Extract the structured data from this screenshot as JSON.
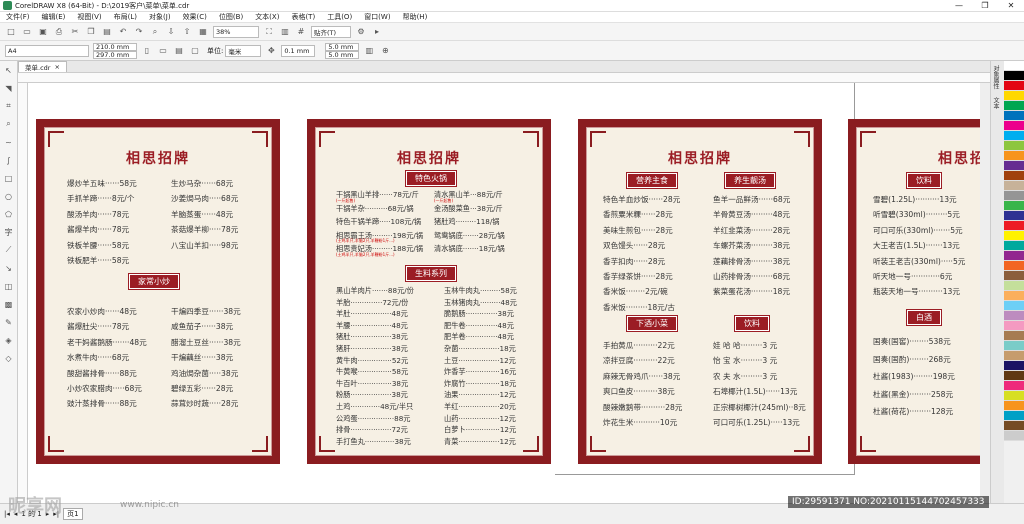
{
  "window": {
    "title": "CorelDRAW X8 (64-Bit) - D:\\2019客户\\菜单\\菜单.cdr",
    "controls": [
      "—",
      "❐",
      "✕"
    ]
  },
  "menu": [
    "文件(F)",
    "编辑(E)",
    "视图(V)",
    "布局(L)",
    "对象(J)",
    "效果(C)",
    "位图(B)",
    "文本(X)",
    "表格(T)",
    "工具(O)",
    "窗口(W)",
    "帮助(H)"
  ],
  "toolbar": {
    "zoom": "38%",
    "snap": "贴齐(T)"
  },
  "props": {
    "page": "A4",
    "width": "210.0 mm",
    "height": "297.0 mm",
    "unit_label": "单位:",
    "unit": "毫米",
    "nudge": "0.1 mm",
    "dup_x": "5.0 mm",
    "dup_y": "5.0 mm"
  },
  "doctab": "菜单.cdr",
  "dock": [
    "对象属性",
    "文本"
  ],
  "colors": [
    "#ffffff",
    "#000000",
    "#e30613",
    "#ffd800",
    "#00a651",
    "#0072bc",
    "#ec008c",
    "#00aeef",
    "#8dc63f",
    "#f7941d",
    "#662d91",
    "#a0410d",
    "#c7b299",
    "#959595",
    "#39b54a",
    "#2e3192",
    "#ed1c24",
    "#fff200",
    "#00a99d",
    "#92278f",
    "#f26522",
    "#8b5e3c",
    "#c4df9b",
    "#fbaf5d",
    "#6dcff6",
    "#bd8cbf",
    "#f49ac1",
    "#a67c52",
    "#7accc8",
    "#c69c6d",
    "#1b1464",
    "#603913",
    "#ee2a7b",
    "#d7df23",
    "#f7941d",
    "#00a0c6",
    "#754c24",
    "#ccc"
  ],
  "status": {
    "pages": "1 的 1",
    "page_tab": "页1"
  },
  "overlay": {
    "watermark": "昵享网",
    "url": "www.nipic.cn",
    "id": "ID:29591371 NO:20210115144702457333"
  },
  "cards": [
    {
      "title": "相思招牌",
      "left": [
        "爆炒羊五味······58元",
        "手抓羊蹄······8元/个",
        "酸汤羊肉······78元",
        "酱爆羊肉······78元",
        "铁板羊腰······58元",
        "铁板肥羊······58元"
      ],
      "right": [
        "生炒马杂······68元",
        "沙姜焗马肉·····68元",
        "羊脑蒸蛋······48元",
        "茶菇爆羊柳·····78元",
        "八宝山羊扣·····98元"
      ],
      "sec": "家常小炒",
      "left2": [
        "农家小炒肉······48元",
        "酱爆肚尖······78元",
        "老干妈酱鹅肠·······48元",
        "水煮牛肉······68元",
        "酸甜酱排骨······88元",
        "小炒农家腊肉·····68元",
        "豉汁蒸排骨······88元"
      ],
      "right2": [
        "干煸四季豆······38元",
        "咸鱼茄子······38元",
        "醋溜土豆丝······38元",
        "干煸藕丝······38元",
        "鸡油焗杂菌·····38元",
        "碧绿五彩······28元",
        "蒜茸炒时蔬·····28元"
      ]
    },
    {
      "title": "相思招牌",
      "sec1": "特色火锅",
      "left": [
        "干锅黑山羊排······78元/斤",
        "干锅羊杂··········68元/锅",
        "特色干锅羊蹄·····108元/锅",
        "相思霸王汤·········198元/锅",
        "相思贵妃汤·········188元/锅"
      ],
      "right": [
        "清水黑山羊···88元/斤",
        "金汤酸菜鱼···38元/斤",
        "猪肚鸡·········118/锅",
        "鸳鸯锅底·······28元/锅",
        "清水锅底·······18元/锅"
      ],
      "sec2": "生料系列",
      "left2": [
        "黑山羊肉片·······88元/份",
        "羊胎··············72元/份",
        "羊肚··················48元",
        "羊腰··················48元",
        "猪肚··················38元",
        "猪肝··················38元",
        "黄牛肉···············52元",
        "牛黄喉···············58元",
        "牛百叶···············38元",
        "粉肠··················38元",
        "土鸡·············48元/半只",
        "公鸡蛋················88元",
        "排骨··················72元",
        "手打鱼丸·············38元"
      ],
      "right2": [
        "玉林牛肉丸·········58元",
        "玉林猪肉丸·········48元",
        "脆鹅肠··············38元",
        "肥牛卷··············48元",
        "肥羊卷··············48元",
        "杂菌··················18元",
        "土豆··················12元",
        "炸香芋···············16元",
        "炸腐竹···············18元",
        "油果··················12元",
        "羊红··················20元",
        "山药··················12元",
        "白萝卜···············12元",
        "青菜··················12元"
      ],
      "notes": [
        "(一斤起售)",
        "(一斤起售)",
        "(土鸡半只,羊脑2只,羊鞭粉1斤...)",
        "(土鸡半只,羊脑2只,羊鞭粉1斤...)"
      ]
    },
    {
      "title": "相思招牌",
      "sec1": "营养主食",
      "sec2": "养生靓汤",
      "sec3": "下酒小菜",
      "sec4": "饮料",
      "a": [
        "特色羊血炒饭······28元",
        "香煎粟米粿······28元",
        "美味生煎包······28元",
        "双色馒头······28元",
        "香芋扣肉······28元",
        "香芋绿茶饼······28元",
        "香米饭········2元/碗",
        "香米饭·········18元/古"
      ],
      "b": [
        "鱼羊一品鲜汤······68元",
        "羊骨黄豆汤·········48元",
        "羊红韭菜汤·········28元",
        "车螺芥菜汤·········38元",
        "莲藕排骨汤·········38元",
        "山药排骨汤·········68元",
        "紫菜蛋花汤·········18元"
      ],
      "c": [
        "手拍黄瓜··········22元",
        "凉拌豆腐··········22元",
        "麻辣无骨鸡爪······38元",
        "爽口鱼皮··········38元",
        "酸辣嫩鹅带··········28元",
        "炸花生米···········10元"
      ],
      "d": [
        "娃 哈 哈·········3 元",
        "怡 宝 水·········3 元",
        "农 夫 水·········3 元",
        "石埠椰汁(1.5L)······13元",
        "正宗椰树椰汁(245ml)··8元",
        "可口可乐(1.25L)·····13元"
      ]
    },
    {
      "title": "相思招牌",
      "sec1": "饮料",
      "sec2": "白酒",
      "a": [
        "雪碧(1.25L)··········13元",
        "听雪碧(330ml)·········5元",
        "可口可乐(330ml)·······5元",
        "大王老吉(1.5L)·······13元",
        "听装王老吉(330ml)·····5元",
        "听天地一号············6元",
        "瓶装天地一号··········13元"
      ],
      "b": [
        "国奏(国窖)········538元",
        "国奏(国酌)········268元",
        "杜酱(1983)········198元",
        "杜酱(黑金)·········258元",
        "杜酱(荷花)·········128元"
      ]
    }
  ]
}
